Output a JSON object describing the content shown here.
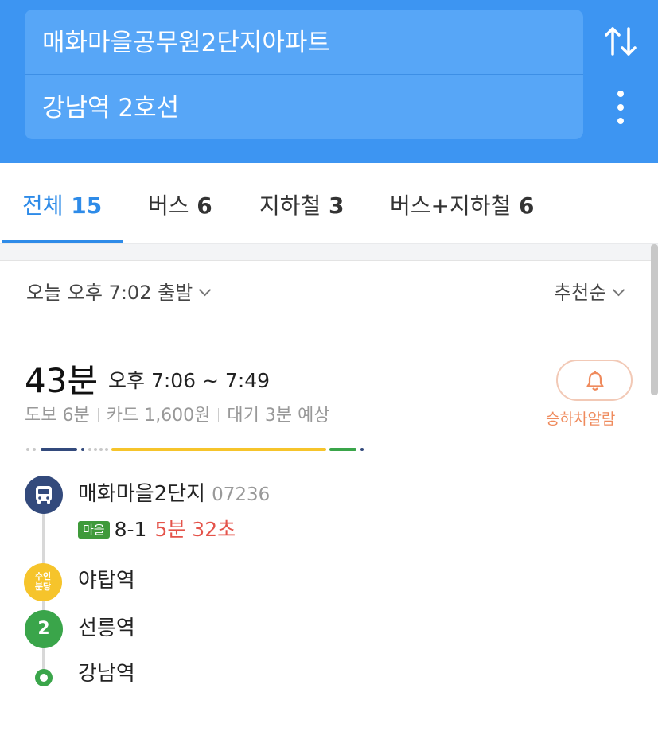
{
  "search": {
    "origin": "매화마을공무원2단지아파트",
    "destination": "강남역 2호선"
  },
  "icons": {
    "swap": "swap-vertical-arrows-icon",
    "more": "more-vertical-icon",
    "sort_chevron": "chevron-down-icon",
    "alarm": "bell-icon",
    "bus": "bus-icon"
  },
  "tabs": [
    {
      "label": "전체",
      "count": "15",
      "active": true
    },
    {
      "label": "버스",
      "count": "6"
    },
    {
      "label": "지하철",
      "count": "3"
    },
    {
      "label": "버스+지하철",
      "count": "6"
    }
  ],
  "filter": {
    "departure": "오늘 오후 7:02 출발",
    "sort": "추천순"
  },
  "route": {
    "duration": "43분",
    "time_range": "오후 7:06 ~ 7:49",
    "walk": "도보 6분",
    "fare": "카드 1,600원",
    "wait": "대기 3분 예상",
    "alarm_label": "승하차알람",
    "segment_colors": {
      "walk": "#c8c8c8",
      "bus": "#334a7c",
      "suin_bundang": "#f6c42b",
      "line2": "#3aa54a",
      "alarm_accent": "#ef8a5c"
    },
    "stops": [
      {
        "name": "매화마을2단지",
        "code": "07236"
      },
      {
        "name": "야탑역",
        "line_badge": "수인\n분당"
      },
      {
        "name": "선릉역",
        "line_badge": "2"
      },
      {
        "name": "강남역"
      }
    ],
    "bus_route": {
      "badge": "마을",
      "number": "8-1",
      "arrival": "5분 32초"
    }
  },
  "colors": {
    "header": "#3d95f2",
    "accent": "#2e8be8"
  }
}
